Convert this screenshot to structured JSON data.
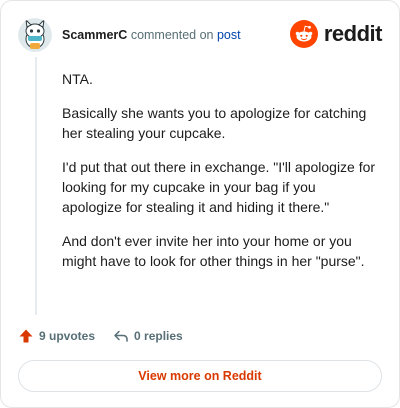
{
  "header": {
    "username": "ScammerC",
    "action_text": "commented on",
    "post_link": "post",
    "brand_name": "reddit"
  },
  "comment": {
    "paragraphs": [
      "NTA.",
      "Basically she wants you to apologize for catching her stealing your cupcake.",
      "I'd put that out there in exchange. \"I'll apologize for looking for my cupcake in your bag if you apologize for stealing it and hiding it there.\"",
      "And don't ever invite her into your home or you might have to look for other things in her \"purse\"."
    ]
  },
  "actions": {
    "upvotes_label": "9 upvotes",
    "replies_label": "0 replies"
  },
  "footer": {
    "view_more_label": "View more on Reddit"
  },
  "colors": {
    "brand_orange": "#ff4500",
    "upvote_orange": "#d93900",
    "link_blue": "#0045ac",
    "muted_text": "#576f76"
  },
  "icons": {
    "avatar": "snoo-avatar-icon",
    "brand": "reddit-logo-icon",
    "upvote": "upvote-arrow-icon",
    "reply": "reply-arrow-icon"
  }
}
